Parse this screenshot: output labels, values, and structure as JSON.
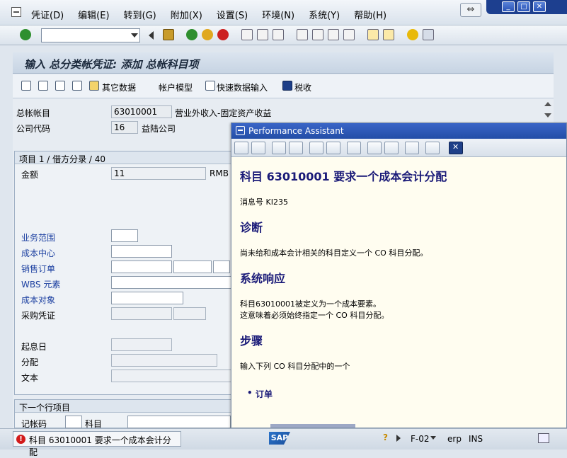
{
  "menu": {
    "items": [
      "凭证(D)",
      "编辑(E)",
      "转到(G)",
      "附加(X)",
      "设置(S)",
      "环境(N)",
      "系统(Y)",
      "帮助(H)"
    ]
  },
  "window_controls": {
    "back": "⇔",
    "minimize": "_",
    "maximize": "□",
    "close": "✕"
  },
  "title": "输入 总分类帐凭证: 添加 总帐科目项",
  "appbar": {
    "other_data": "其它数据",
    "account_model": "帐户模型",
    "fast_entry": "快速数据输入",
    "tax": "税收"
  },
  "header_fields": {
    "gl_account_label": "总帐帐目",
    "gl_account_value": "63010001",
    "gl_account_desc": "营业外收入-固定资产收益",
    "company_code_label": "公司代码",
    "company_code_value": "16",
    "company_code_desc": "益陆公司"
  },
  "item_group": {
    "header": "项目 1 / 借方分录 / 40",
    "amount_label": "金额",
    "amount_value": "11",
    "currency": "RMB",
    "business_area": "业务范围",
    "cost_center": "成本中心",
    "sales_order": "销售订单",
    "wbs": "WBS 元素",
    "cost_object": "成本对象",
    "purchase_doc": "采购凭证",
    "start_date": "起息日",
    "assignment": "分配",
    "text": "文本"
  },
  "next_item": {
    "header": "下一个行项目",
    "posting_key": "记帐码",
    "account": "科目"
  },
  "status": {
    "message": "科目 63010001 要求一个成本会计分配",
    "logo": "SAP",
    "tcode": "F-02",
    "system": "erp",
    "mode": "INS"
  },
  "assistant": {
    "title": "Performance Assistant",
    "heading": "科目 63010001 要求一个成本会计分配",
    "msg_no": "消息号 KI235",
    "diag_title": "诊断",
    "diag_text": "尚未给和成本会计相关的科目定义一个 CO 科目分配。",
    "resp_title": "系统响应",
    "resp_text1": "科目63010001被定义为一个成本要素。",
    "resp_text2": "这意味着必须始终指定一个 CO 科目分配。",
    "steps_title": "步骤",
    "steps_text": "输入下列 CO 科目分配中的一个",
    "bullet1": "订单"
  }
}
